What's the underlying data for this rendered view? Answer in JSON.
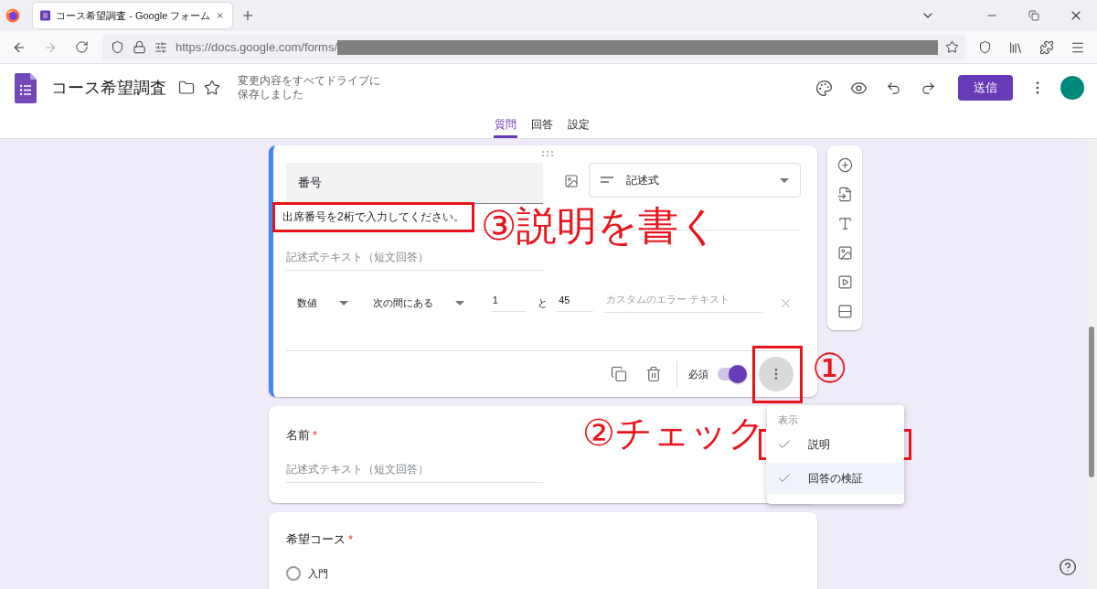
{
  "browser": {
    "tab_title": "コース希望調査 - Google フォーム",
    "url_host": "https://docs.google.com/forms/",
    "url_redacted": true
  },
  "form_header": {
    "title": "コース希望調査",
    "save_status": [
      "変更内容をすべてドライブに",
      "保存しました"
    ],
    "send_button": "送信"
  },
  "tabs": [
    {
      "label": "質問",
      "selected": true
    },
    {
      "label": "回答",
      "selected": false
    },
    {
      "label": "設定",
      "selected": false
    }
  ],
  "questions": [
    {
      "kind": "short",
      "title": "番号",
      "required": true,
      "active": true,
      "type_label": "記述式",
      "description": "出席番号を2桁で入力してください。",
      "description_highlighted": true,
      "placeholder": "記述式テキスト（短文回答）",
      "validation": {
        "type": "数値",
        "condition": "次の間にある",
        "min": "1",
        "joiner": "と",
        "max": "45",
        "error_placeholder": "カスタムのエラー テキスト"
      },
      "required_label": "必須",
      "more_highlighted": true
    },
    {
      "kind": "short",
      "title": "名前",
      "required": true,
      "required_mark": "*",
      "active": false,
      "placeholder": "記述式テキスト（短文回答）"
    },
    {
      "kind": "choice",
      "title": "希望コース",
      "required": true,
      "required_mark": "*",
      "active": false,
      "options": [
        {
          "label": "入門",
          "selected": false
        }
      ]
    }
  ],
  "menu": {
    "heading": "表示",
    "items": [
      {
        "label": "説明",
        "checked": true,
        "highlighted": true
      },
      {
        "label": "回答の検証",
        "checked": true,
        "highlighted": false
      }
    ]
  },
  "annotations": [
    "③説明を書く",
    "①",
    "②チェック"
  ]
}
